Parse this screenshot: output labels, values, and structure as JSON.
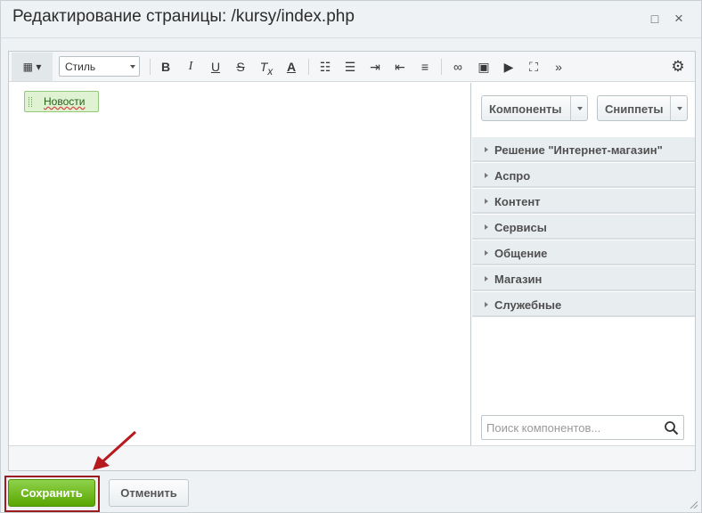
{
  "window": {
    "title": "Редактирование страницы: /kursy/index.php"
  },
  "toolbar": {
    "style_label": "Стиль"
  },
  "content": {
    "news_component": "Новости"
  },
  "panel": {
    "components_label": "Компоненты",
    "snippets_label": "Сниппеты",
    "groups": [
      "Решение \"Интернет-магазин\"",
      "Аспро",
      "Контент",
      "Сервисы",
      "Общение",
      "Магазин",
      "Служебные"
    ],
    "search_placeholder": "Поиск компонентов..."
  },
  "footer": {
    "save_label": "Сохранить",
    "cancel_label": "Отменить"
  },
  "colors": {
    "save_green": "#59a600",
    "highlight_red": "#9b1d21"
  }
}
